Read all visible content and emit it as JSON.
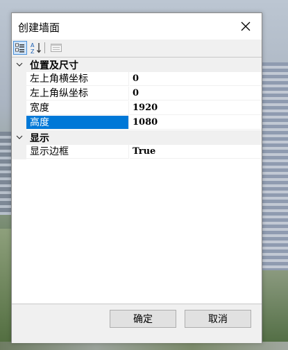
{
  "window": {
    "title": "创建墙面",
    "close_icon": "close-icon"
  },
  "toolbar": {
    "buttons": [
      {
        "icon": "categorized-view-icon",
        "active": true
      },
      {
        "icon": "alphabetical-sort-icon",
        "active": false
      },
      {
        "icon": "property-pages-icon",
        "active": false
      }
    ]
  },
  "property_grid": {
    "categories": [
      {
        "label": "位置及尺寸",
        "properties": [
          {
            "name": "左上角横坐标",
            "value": "0"
          },
          {
            "name": "左上角纵坐标",
            "value": "0"
          },
          {
            "name": "宽度",
            "value": "1920"
          },
          {
            "name": "高度",
            "value": "1080",
            "selected": true
          }
        ]
      },
      {
        "label": "显示",
        "properties": [
          {
            "name": "显示边框",
            "value": "True"
          }
        ]
      }
    ]
  },
  "buttons": {
    "ok_label": "确定",
    "cancel_label": "取消"
  },
  "colors": {
    "selection": "#0078d7",
    "dialog_bg": "#f0f0f0",
    "grid_bg": "#ffffff"
  }
}
